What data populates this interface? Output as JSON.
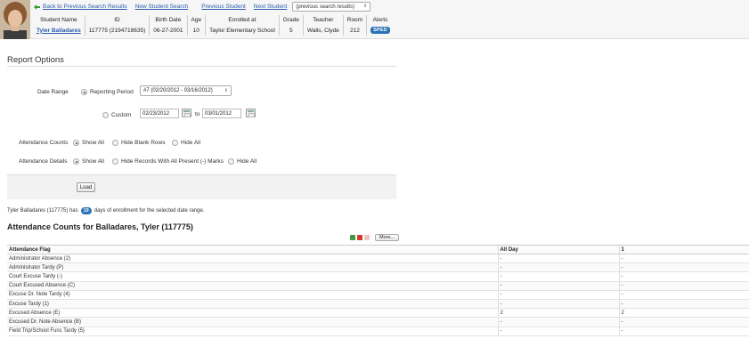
{
  "nav": {
    "back": "Back to Previous Search Results",
    "new_search": "New Student Search",
    "previous": "Previous Student",
    "next": "Next Student",
    "select_value": "(previous search results)"
  },
  "student": {
    "headers": [
      "Student Name",
      "ID",
      "Birth Date",
      "Age",
      "Enrolled at",
      "Grade",
      "Teacher",
      "Room",
      "Alerts"
    ],
    "name": "Tyler Balladares",
    "id": "117775 (2194718635)",
    "birth_date": "06-27-2001",
    "age": "10",
    "enrolled_at": "Taylor Elementary School",
    "grade": "5",
    "teacher": "Walls, Clyde",
    "room": "212",
    "alert": "SPED"
  },
  "report_options": {
    "title": "Report Options",
    "date_range_label": "Date Range",
    "reporting_period_label": "Reporting Period",
    "reporting_period_value": "#7 (02/20/2012 - 03/16/2012)",
    "custom_label": "Custom",
    "custom_from": "02/23/2012",
    "to_label": "to",
    "custom_to": "03/01/2012",
    "attendance_counts_label": "Attendance Counts",
    "counts_options": [
      "Show All",
      "Hide Blank Rows",
      "Hide All"
    ],
    "attendance_details_label": "Attendance Details",
    "details_options": [
      "Show All",
      "Hide Records With All Present (-) Marks",
      "Hide All"
    ],
    "load_label": "Load"
  },
  "enrollment": {
    "prefix": "Tyler Balladares (117775) has",
    "days": "19",
    "suffix": "days of enrollment for the selected date range."
  },
  "attendance": {
    "title": "Attendance Counts for Balladares, Tyler (117775)",
    "more_label": "More...",
    "columns": [
      "Attendance Flag",
      "All Day",
      "1"
    ],
    "rows": [
      [
        "Administrator Absence (2)",
        "-",
        "-"
      ],
      [
        "Administrator Tardy (P)",
        "-",
        "-"
      ],
      [
        "Court Excuse Tardy (-)",
        "-",
        "-"
      ],
      [
        "Court Excused Absence (C)",
        "-",
        "-"
      ],
      [
        "Excuse Dr. Note Tardy (4)",
        "-",
        "-"
      ],
      [
        "Excuse Tardy (1)",
        "-",
        "-"
      ],
      [
        "Excused Absence (E)",
        "2",
        "2"
      ],
      [
        "Excused Dr. Note Absence (B)",
        "-",
        "-"
      ],
      [
        "Field Trip/School Func Tardy (5)",
        "-",
        "-"
      ]
    ]
  },
  "icons": {
    "back_arrow": "green-arrow-icon",
    "calendar": "calendar-icon",
    "export": [
      "excel-icon",
      "pdf-icon",
      "help-icon"
    ]
  },
  "colors": {
    "link": "#2a5db0",
    "badge": "#2b73b7"
  }
}
